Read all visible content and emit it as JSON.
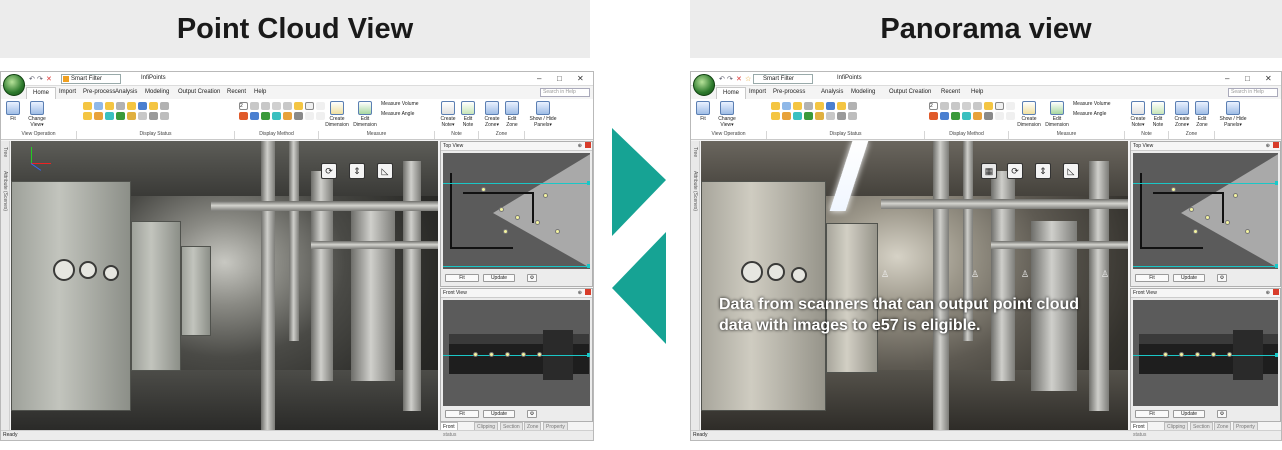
{
  "titles": {
    "left": "Point Cloud View",
    "right": "Panorama view"
  },
  "app": {
    "name": "InfiPoints",
    "smart_filter": "Smart Filter",
    "help_search_placeholder": "Search in Help",
    "window_controls": {
      "minimize": "–",
      "maximize": "□",
      "close": "✕"
    },
    "menu": [
      "Home",
      "Import",
      "Pre-process",
      "Analysis",
      "Modeling",
      "Output Creation",
      "Recent",
      "Help"
    ],
    "active_menu": "Home",
    "ribbon": {
      "fit": "Fit",
      "change_view": "Change View▾",
      "create_dimension": "Create Dimension",
      "edit_dimension": "Edit Dimension",
      "measure_volume": "Measure Volume",
      "measure_angle": "Measure Angle",
      "create_note": "Create Note▾",
      "edit_note": "Edit Note",
      "create_zone": "Create Zone▾",
      "edit_zone": "Edit Zone",
      "show_hide_panels": "Show / Hide Panels▾",
      "display_method_value": "2"
    },
    "groups": {
      "view_operation": "View Operation",
      "display_status": "Display Status",
      "display_method": "Display Method",
      "measure": "Measure",
      "note": "Note",
      "zone": "Zone"
    },
    "side_tabs": [
      "Tree",
      "Attribute (Scenes)"
    ],
    "top_view": {
      "title": "Top View",
      "fit": "Fit",
      "update": "Update"
    },
    "front_view": {
      "title": "Front View",
      "fit": "Fit",
      "update": "Update"
    },
    "bottom_tabs": [
      "Front View",
      "Clipping",
      "Section",
      "Zone",
      "Property"
    ],
    "status_left": "Ready",
    "status_right": "status"
  },
  "panorama_caption": "Data from scanners that can output point cloud data with images to e57 is eligible.",
  "colors": {
    "accent_teal": "#16A394",
    "title_bg": "#ECECEC",
    "close_red": "#D83C2A",
    "cyan": "#1AC7C7"
  }
}
